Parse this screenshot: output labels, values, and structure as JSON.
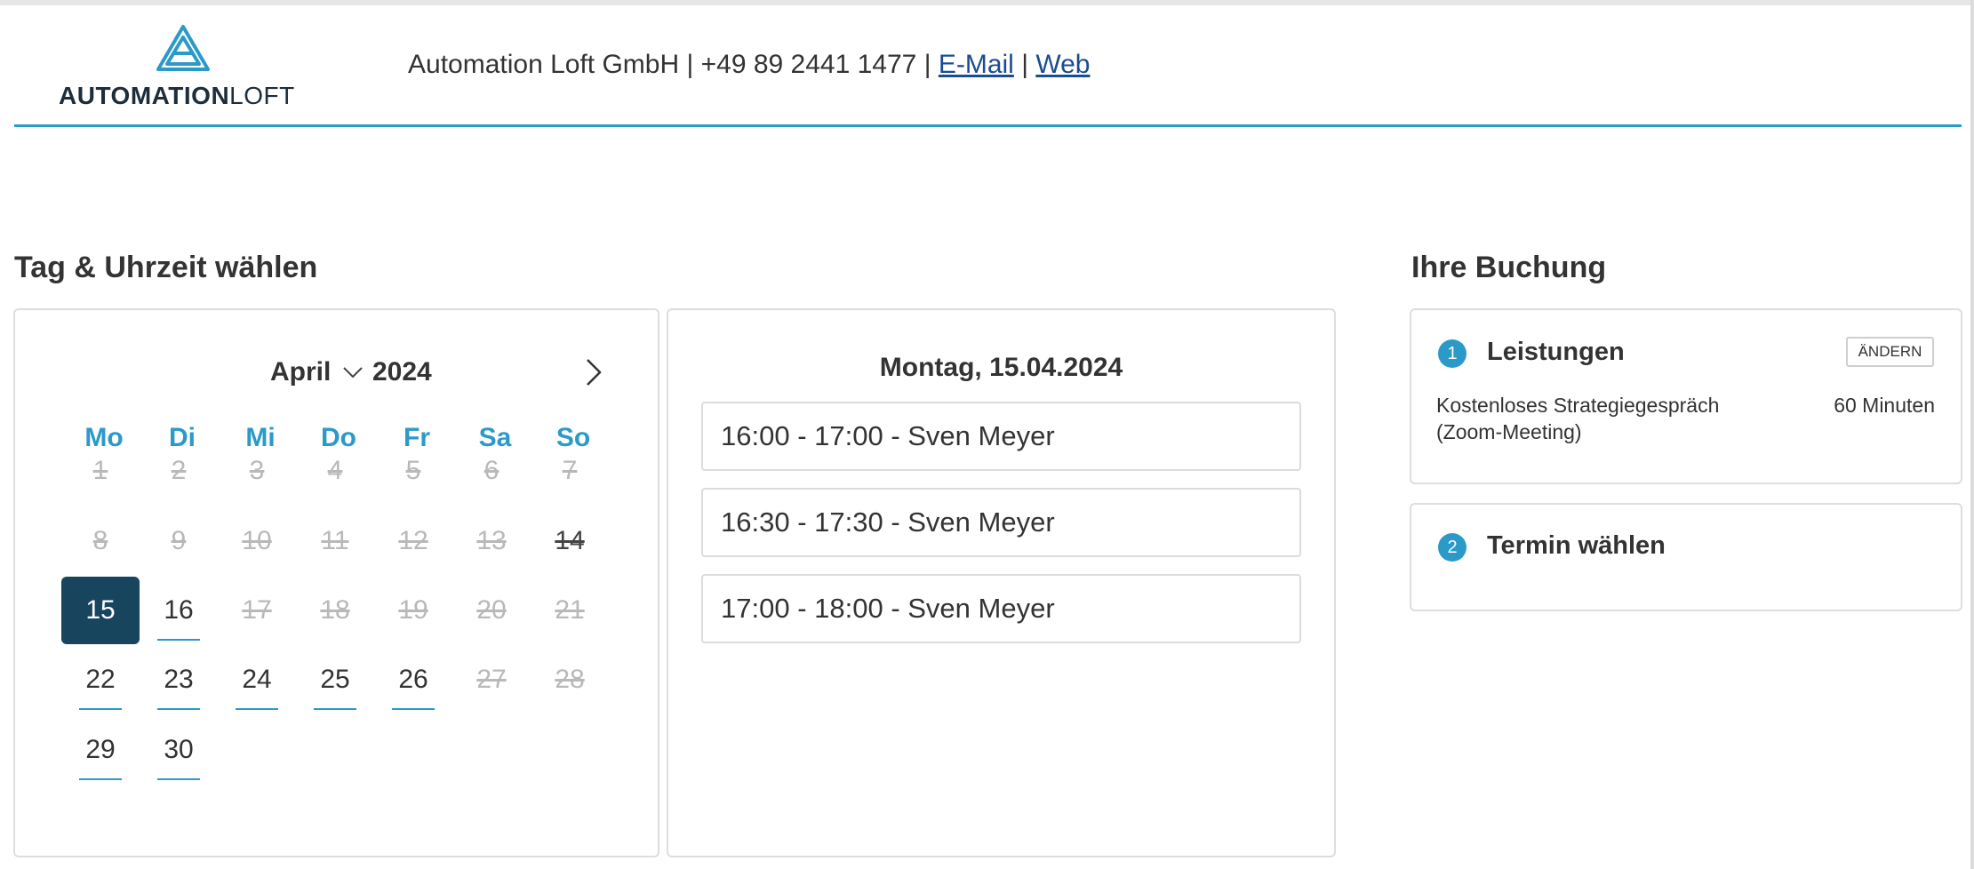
{
  "header": {
    "logo_bold": "AUTOMATION",
    "logo_light": "LOFT",
    "company": "Automation Loft GmbH",
    "sep1": " | ",
    "phone": "+49 89 2441 1477",
    "sep2": " | ",
    "email_link": "E-Mail",
    "sep3": " | ",
    "web_link": "Web"
  },
  "colors": {
    "accent": "#2b9ac9",
    "selected": "#17455e",
    "link": "#1a4d8f"
  },
  "calendar_section": {
    "title": "Tag & Uhrzeit wählen"
  },
  "calendar": {
    "month": "April",
    "year": "2024",
    "month_dropdown_icon": "chevron-down-icon",
    "next_icon": "chevron-right-icon",
    "weekdays": [
      "Mo",
      "Di",
      "Mi",
      "Do",
      "Fr",
      "Sa",
      "So"
    ],
    "weeks": [
      [
        {
          "d": "1",
          "s": "disabled"
        },
        {
          "d": "2",
          "s": "disabled"
        },
        {
          "d": "3",
          "s": "disabled"
        },
        {
          "d": "4",
          "s": "disabled"
        },
        {
          "d": "5",
          "s": "disabled"
        },
        {
          "d": "6",
          "s": "disabled"
        },
        {
          "d": "7",
          "s": "disabled"
        }
      ],
      [
        {
          "d": "8",
          "s": "disabled"
        },
        {
          "d": "9",
          "s": "disabled"
        },
        {
          "d": "10",
          "s": "disabled"
        },
        {
          "d": "11",
          "s": "disabled"
        },
        {
          "d": "12",
          "s": "disabled"
        },
        {
          "d": "13",
          "s": "disabled"
        },
        {
          "d": "14",
          "s": "disabled-today"
        }
      ],
      [
        {
          "d": "15",
          "s": "selected"
        },
        {
          "d": "16",
          "s": "available"
        },
        {
          "d": "17",
          "s": "disabled"
        },
        {
          "d": "18",
          "s": "disabled"
        },
        {
          "d": "19",
          "s": "disabled"
        },
        {
          "d": "20",
          "s": "disabled"
        },
        {
          "d": "21",
          "s": "disabled"
        }
      ],
      [
        {
          "d": "22",
          "s": "available"
        },
        {
          "d": "23",
          "s": "available"
        },
        {
          "d": "24",
          "s": "available"
        },
        {
          "d": "25",
          "s": "available"
        },
        {
          "d": "26",
          "s": "available"
        },
        {
          "d": "27",
          "s": "disabled"
        },
        {
          "d": "28",
          "s": "disabled"
        }
      ],
      [
        {
          "d": "29",
          "s": "available"
        },
        {
          "d": "30",
          "s": "available"
        }
      ]
    ]
  },
  "slots": {
    "date": "Montag, 15.04.2024",
    "items": [
      "16:00 - 17:00 - Sven Meyer",
      "16:30 - 17:30 - Sven Meyer",
      "17:00 - 18:00 - Sven Meyer"
    ]
  },
  "booking": {
    "title": "Ihre Buchung",
    "step1": {
      "number": "1",
      "title": "Leistungen",
      "change_label": "ÄNDERN",
      "service_name": "Kostenloses Strategiegespräch (Zoom-Meeting)",
      "duration": "60 Minuten"
    },
    "step2": {
      "number": "2",
      "title": "Termin wählen"
    }
  }
}
